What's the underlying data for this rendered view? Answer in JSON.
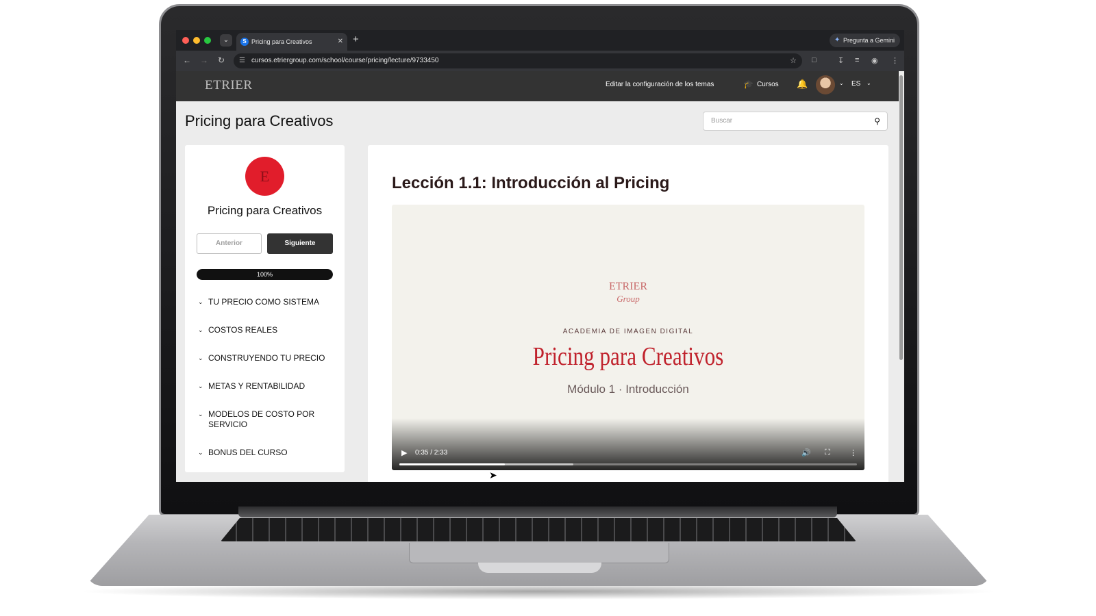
{
  "browser": {
    "tab_title": "Pricing para Creativos",
    "tab_favicon": "S",
    "gemini_label": "Pregunta a Gemini",
    "url": "cursos.etriergroup.com/school/course/pricing/lecture/9733450"
  },
  "site_header": {
    "logo": "ETRIER",
    "theme_link": "Editar la configuración de los temas",
    "courses_link": "Cursos",
    "language": "ES"
  },
  "page": {
    "title": "Pricing para Creativos",
    "search_placeholder": "Buscar"
  },
  "sidebar": {
    "logo_letter": "E",
    "course_name": "Pricing para Creativos",
    "prev_label": "Anterior",
    "next_label": "Siguiente",
    "progress_label": "100%",
    "progress_fraction": 1.0,
    "modules": [
      "TU PRECIO COMO SISTEMA",
      "COSTOS REALES",
      "CONSTRUYENDO TU PRECIO",
      "METAS Y RENTABILIDAD",
      "MODELOS DE COSTO POR SERVICIO",
      "BONUS DEL CURSO"
    ]
  },
  "lesson": {
    "title": "Lección 1.1: Introducción al Pricing",
    "video": {
      "logo_top": "ETRIER",
      "logo_bottom": "Group",
      "academy": "ACADEMIA DE IMAGEN DIGITAL",
      "title": "Pricing para Creativos",
      "module": "Módulo 1 · Introducción",
      "time": "0:35 / 2:33",
      "played_fraction": 0.23,
      "buffered_fraction": 0.38
    }
  },
  "colors": {
    "brand_red": "#e11d2b",
    "header_bg": "#333333",
    "video_bg": "#f3f2ec"
  }
}
